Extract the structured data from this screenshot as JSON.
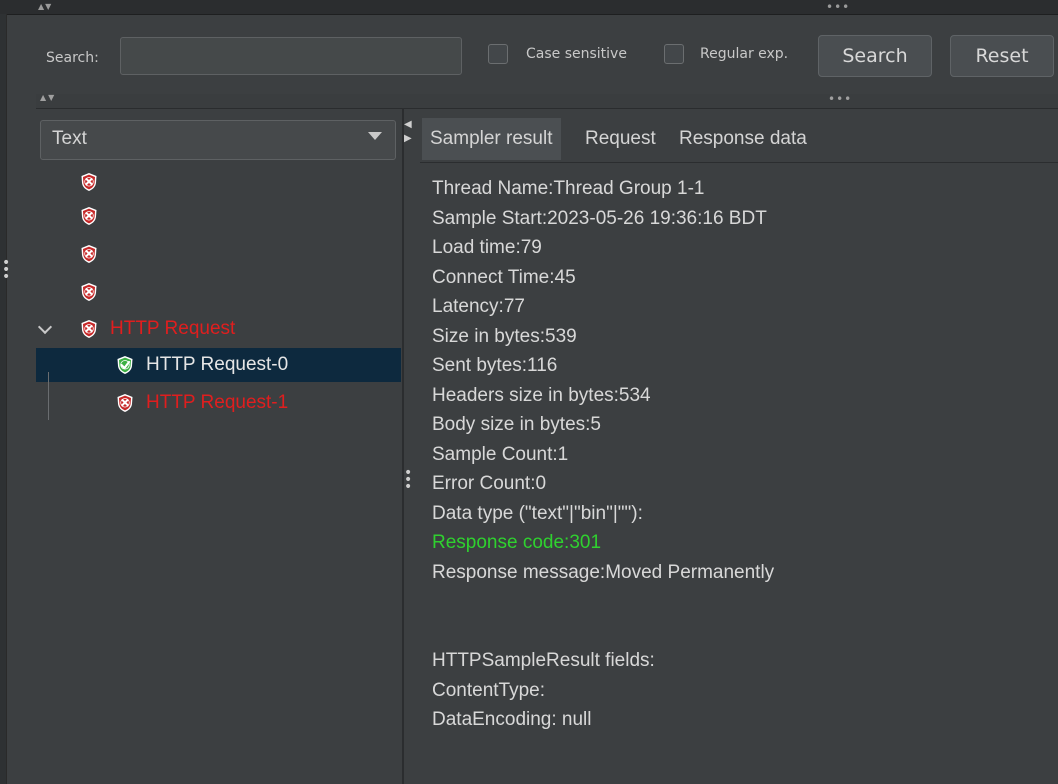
{
  "search": {
    "label": "Search:",
    "value": "",
    "case_sensitive_label": "Case sensitive",
    "case_sensitive_checked": false,
    "regex_label": "Regular exp.",
    "regex_checked": false,
    "search_button": "Search",
    "reset_button": "Reset"
  },
  "renderer": {
    "selected": "Text"
  },
  "tree": {
    "items": [
      {
        "label": "",
        "status": "error",
        "indent": 0
      },
      {
        "label": "",
        "status": "error",
        "indent": 0
      },
      {
        "label": "",
        "status": "error",
        "indent": 0
      },
      {
        "label": "",
        "status": "error",
        "indent": 0
      },
      {
        "label": "HTTP Request",
        "status": "error",
        "indent": 0,
        "expanded": true
      },
      {
        "label": "HTTP Request-0",
        "status": "success",
        "indent": 1,
        "selected": true
      },
      {
        "label": "HTTP Request-1",
        "status": "error",
        "indent": 1
      }
    ]
  },
  "tabs": [
    {
      "label": "Sampler result",
      "active": true
    },
    {
      "label": "Request",
      "active": false
    },
    {
      "label": "Response data",
      "active": false
    }
  ],
  "sampler_result": {
    "lines": [
      "Thread Name:Thread Group 1-1",
      "Sample Start:2023-05-26 19:36:16 BDT",
      "Load time:79",
      "Connect Time:45",
      "Latency:77",
      "Size in bytes:539",
      "Sent bytes:116",
      "Headers size in bytes:534",
      "Body size in bytes:5",
      "Sample Count:1",
      "Error Count:0",
      "Data type (\"text\"|\"bin\"|\"\"):",
      "Response code:301",
      "Response message:Moved Permanently",
      "",
      "",
      "HTTPSampleResult fields:",
      "ContentType:",
      "DataEncoding: null"
    ]
  },
  "colors": {
    "background": "#3c3f41",
    "error_text": "#e01e1e",
    "success_icon": "#3cb043",
    "error_icon": "#c62828",
    "response_code": "#2fd12f",
    "selection": "#0d293e"
  }
}
